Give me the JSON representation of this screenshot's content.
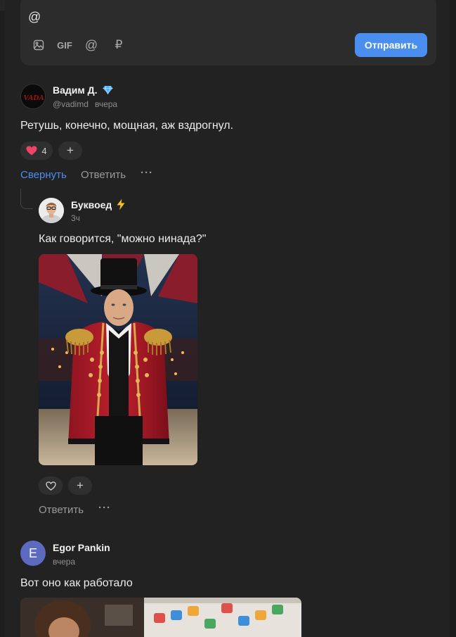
{
  "composer": {
    "input_value": "@",
    "tools": [
      "image-icon",
      "gif-icon",
      "mention-icon",
      "ruble-icon"
    ],
    "gif_label": "GIF",
    "mention_glyph": "@",
    "ruble_glyph": "₽",
    "send_label": "Отправить"
  },
  "comments": [
    {
      "author": "Вадим Д.",
      "badge": "diamond-icon",
      "handle": "@vadimd",
      "time": "вчера",
      "text": "Ретушь, конечно, мощная, аж вздрогнул.",
      "reaction_count": "4",
      "reaction_add": "+",
      "collapse_label": "Свернуть",
      "reply_label": "Ответить",
      "more": "···",
      "avatar_text": "VADA"
    },
    {
      "author": "Буквоед",
      "badge": "lightning-icon",
      "time": "3ч",
      "text": "Как говорится, \"можно нинада?\"",
      "reaction_add": "+",
      "reply_label": "Ответить",
      "more": "···"
    },
    {
      "author": "Egor Pankin",
      "avatar_letter": "E",
      "time": "вчера",
      "text": "Вот оно как работало"
    }
  ],
  "colors": {
    "accent": "#4a8ff0",
    "background": "#222222",
    "avatar_e": "#5c6bc0"
  }
}
